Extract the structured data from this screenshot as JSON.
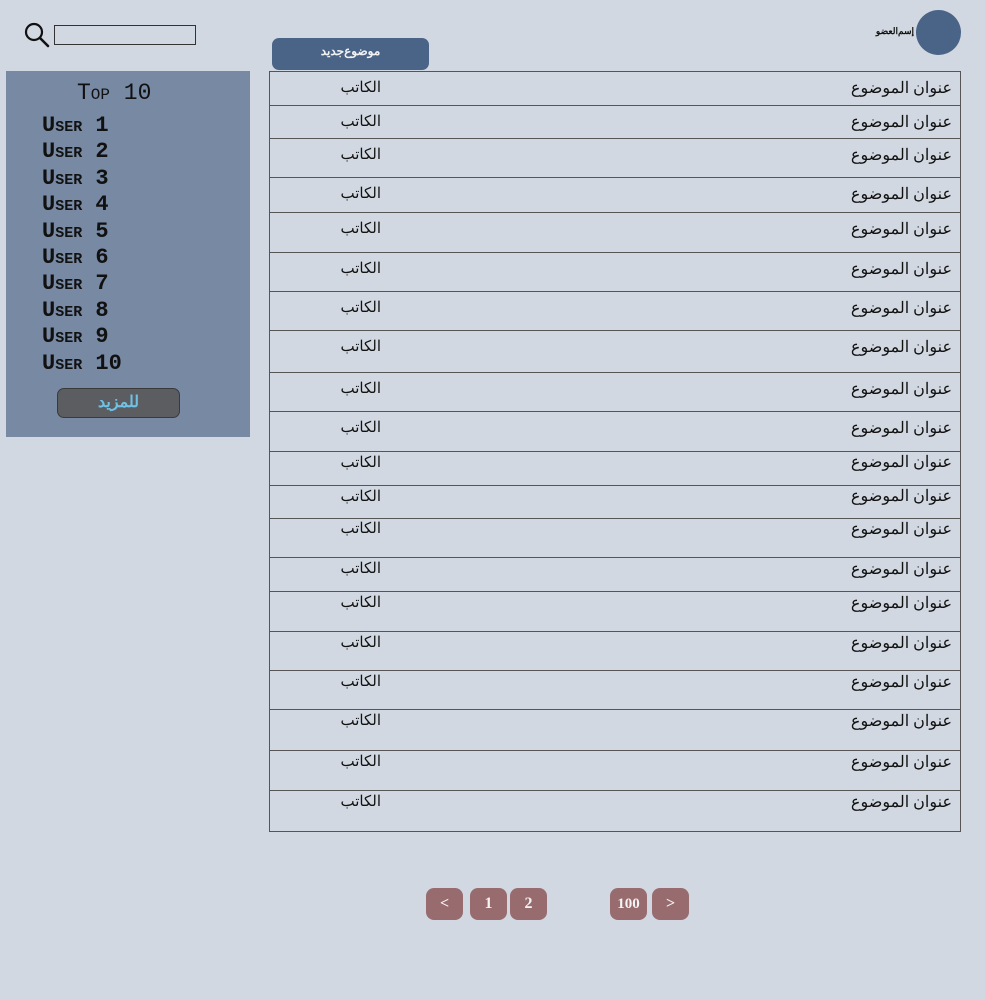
{
  "header": {
    "new_topic_label": "موضوع‌جديد",
    "username": "إسم‌العضو",
    "search_placeholder": ""
  },
  "top_panel": {
    "title": "Top 10",
    "users": [
      "User 1",
      "User 2",
      "User 3",
      "User 4",
      "User 5",
      "User 6",
      "User 7",
      "User 8",
      "User 9",
      "User 10"
    ],
    "more_label": "للمزيد"
  },
  "topics": [
    {
      "title": "عنوان الموضوع",
      "author": "الكاتب"
    },
    {
      "title": "عنوان الموضوع",
      "author": "الكاتب"
    },
    {
      "title": "عنوان الموضوع",
      "author": "الكاتب"
    },
    {
      "title": "عنوان الموضوع",
      "author": "الكاتب"
    },
    {
      "title": "عنوان الموضوع",
      "author": "الكاتب"
    },
    {
      "title": "عنوان الموضوع",
      "author": "الكاتب"
    },
    {
      "title": "عنوان الموضوع",
      "author": "الكاتب"
    },
    {
      "title": "عنوان الموضوع",
      "author": "الكاتب"
    },
    {
      "title": "عنوان الموضوع",
      "author": "الكاتب"
    },
    {
      "title": "عنوان الموضوع",
      "author": "الكاتب"
    },
    {
      "title": "عنوان الموضوع",
      "author": "الكاتب"
    },
    {
      "title": "عنوان الموضوع",
      "author": "الكاتب"
    },
    {
      "title": "عنوان الموضوع",
      "author": "الكاتب"
    },
    {
      "title": "عنوان الموضوع",
      "author": "الكاتب"
    },
    {
      "title": "عنوان الموضوع",
      "author": "الكاتب"
    },
    {
      "title": "عنوان الموضوع",
      "author": "الكاتب"
    },
    {
      "title": "عنوان الموضوع",
      "author": "الكاتب"
    },
    {
      "title": "عنوان الموضوع",
      "author": "الكاتب"
    },
    {
      "title": "عنوان الموضوع",
      "author": "الكاتب"
    },
    {
      "title": "عنوان الموضوع",
      "author": "الكاتب"
    }
  ],
  "pagination": {
    "prev_label": "<",
    "pages": [
      "1",
      "2"
    ],
    "last_page": "100",
    "next_label": ">"
  },
  "colors": {
    "background": "#d1d8e1",
    "accent": "#4a6488",
    "panel": "#7789a3",
    "page_button": "#986b6e",
    "more_text": "#6fc1e6"
  }
}
